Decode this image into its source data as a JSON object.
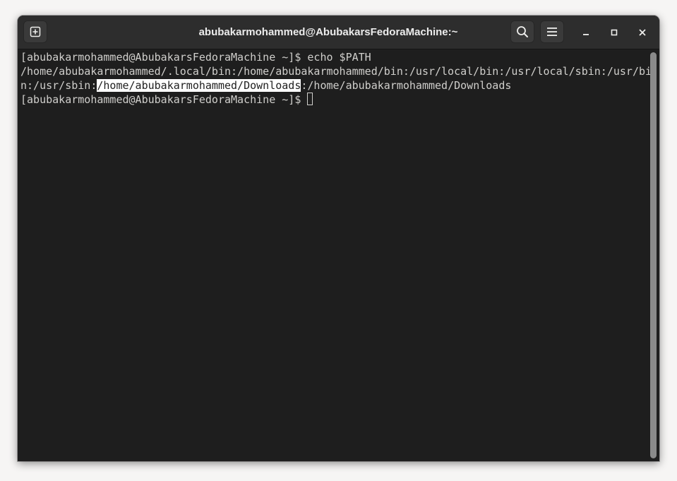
{
  "window": {
    "title": "abubakarmohammed@AbubakarsFedoraMachine:~"
  },
  "headerbar": {
    "new_tab_icon": "new-tab-icon",
    "search_icon": "search-icon",
    "menu_icon": "hamburger-menu-icon",
    "minimize_icon": "minimize-icon",
    "maximize_icon": "maximize-icon",
    "close_icon": "close-icon"
  },
  "terminal": {
    "line1": "[abubakarmohammed@AbubakarsFedoraMachine ~]$ echo $PATH",
    "line2": "/home/abubakarmohammed/.local/bin:/home/abubakarmohammed/bin:/usr/local/bin:/usr/local/sbin:/usr/bi",
    "line3_before": "n:/usr/sbin:",
    "line3_selected": "/home/abubakarmohammed/Downloads",
    "line3_after": ":/home/abubakarmohammed/Downloads",
    "line4_prompt": "[abubakarmohammed@AbubakarsFedoraMachine ~]$ "
  },
  "colors": {
    "terminal_bg": "#1e1e1e",
    "terminal_fg": "#d0cfcc",
    "headerbar_bg": "#2d2d2d",
    "selection_bg": "#ffffff"
  }
}
